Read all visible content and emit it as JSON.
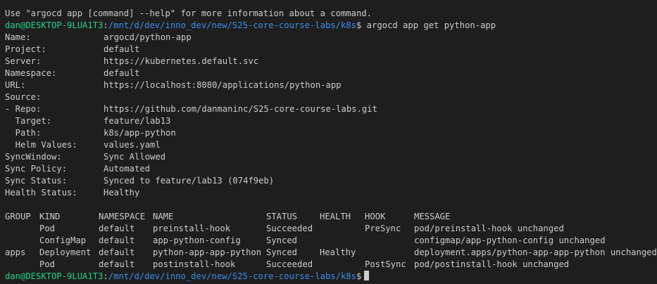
{
  "prompt": {
    "user_host": "dan@DESKTOP-9LUA1T3",
    "sep": ":",
    "path": "/mnt/d/dev/inno_dev/new/S25-core-course-labs/k8s",
    "dollar": "$"
  },
  "help_line": "Use \"argocd app [command] --help\" for more information about a command.",
  "command": "argocd app get python-app",
  "fields": [
    {
      "key": "Name:",
      "value": "argocd/python-app"
    },
    {
      "key": "Project:",
      "value": "default"
    },
    {
      "key": "Server:",
      "value": "https://kubernetes.default.svc"
    },
    {
      "key": "Namespace:",
      "value": "default"
    },
    {
      "key": "URL:",
      "value": "https://localhost:8080/applications/python-app"
    },
    {
      "key": "Source:",
      "value": ""
    },
    {
      "key": "- Repo:",
      "value": "https://github.com/danmaninc/S25-core-course-labs.git"
    },
    {
      "key": "  Target:",
      "value": "feature/lab13"
    },
    {
      "key": "  Path:",
      "value": "k8s/app-python"
    },
    {
      "key": "  Helm Values:",
      "value": "values.yaml"
    },
    {
      "key": "SyncWindow:",
      "value": "Sync Allowed"
    },
    {
      "key": "Sync Policy:",
      "value": "Automated"
    },
    {
      "key": "Sync Status:",
      "value": "Synced to feature/lab13 (074f9eb)"
    },
    {
      "key": "Health Status:",
      "value": "Healthy"
    }
  ],
  "table": {
    "headers": [
      "GROUP",
      "KIND",
      "NAMESPACE",
      "NAME",
      "STATUS",
      "HEALTH",
      "HOOK",
      "MESSAGE"
    ],
    "rows": [
      [
        "",
        "Pod",
        "default",
        "preinstall-hook",
        "Succeeded",
        "",
        "PreSync",
        "pod/preinstall-hook unchanged"
      ],
      [
        "",
        "ConfigMap",
        "default",
        "app-python-config",
        "Synced",
        "",
        "",
        "configmap/app-python-config unchanged"
      ],
      [
        "apps",
        "Deployment",
        "default",
        "python-app-app-python",
        "Synced",
        "Healthy",
        "",
        "deployment.apps/python-app-app-python unchanged"
      ],
      [
        "",
        "Pod",
        "default",
        "postinstall-hook",
        "Succeeded",
        "",
        "PostSync",
        "pod/postinstall-hook unchanged"
      ]
    ]
  },
  "colors": {
    "background": "#1e1e1e",
    "text": "#cccccc",
    "user_host": "#23d18b",
    "path": "#3b8eea"
  }
}
